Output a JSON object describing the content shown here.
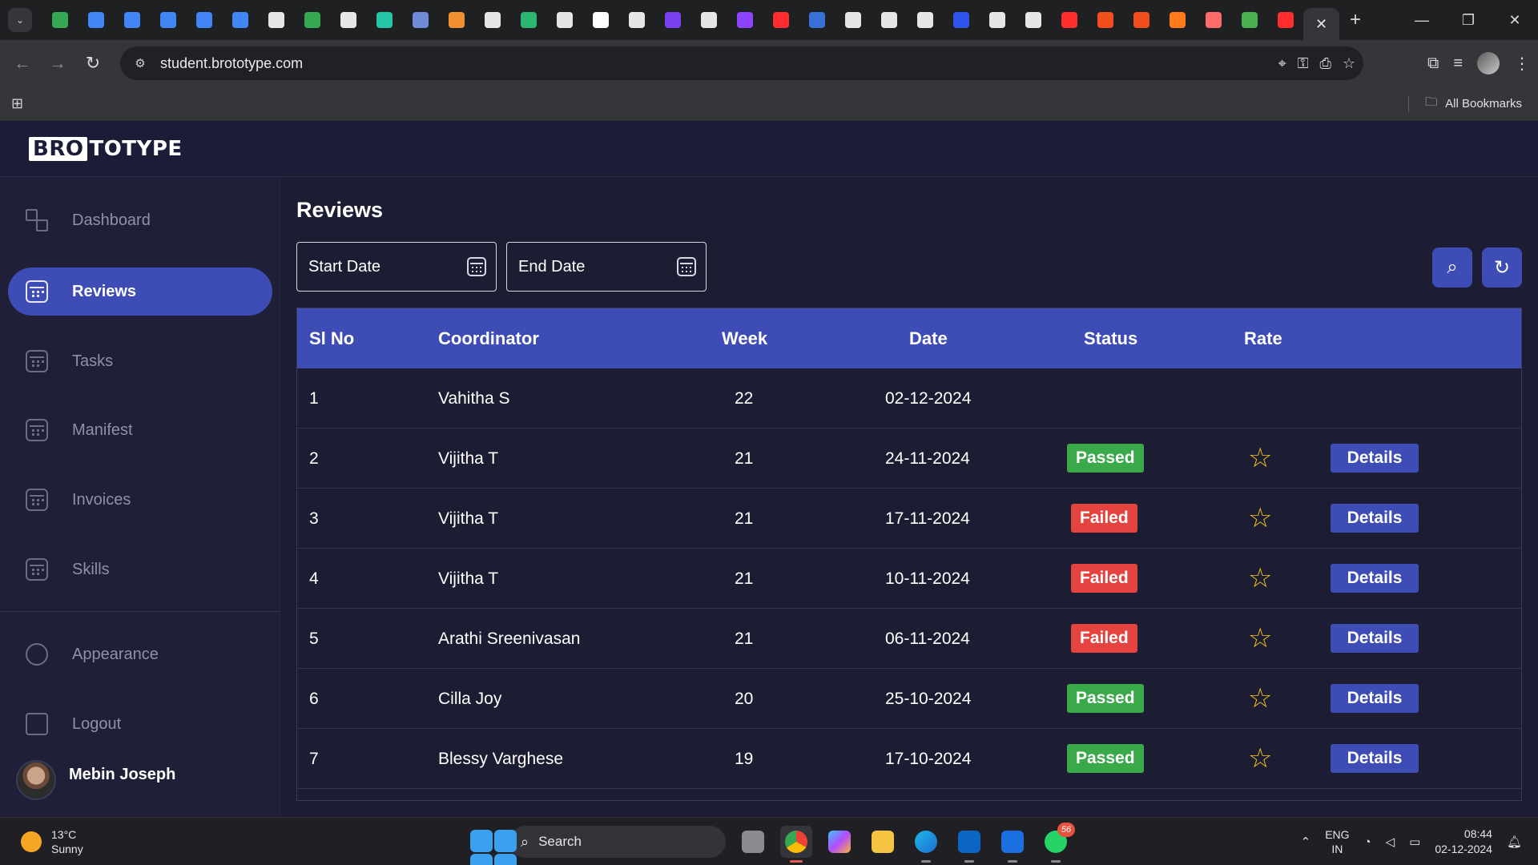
{
  "browser": {
    "url": "student.brototype.com",
    "bookmarks_label": "All Bookmarks",
    "favicon_colors": [
      "#34a853",
      "#4285f4",
      "#4285f4",
      "#4285f4",
      "#4285f4",
      "#4285f4",
      "#e6e6e6",
      "#34a853",
      "#e6e6e6",
      "#26c6a8",
      "#6f8bd8",
      "#f0902f",
      "#e6e6e6",
      "#2bb673",
      "#e6e6e6",
      "#ffffff",
      "#e6e6e6",
      "#7b3ff2",
      "#e6e6e6",
      "#8e44ff",
      "#ff2d2d",
      "#3b6fd8",
      "#e6e6e6",
      "#e6e6e6",
      "#e6e6e6",
      "#2f54eb",
      "#e6e6e6",
      "#e6e6e6",
      "#ff2d2d",
      "#f24e1e",
      "#f24e1e",
      "#ff7a1a",
      "#ff6b6b",
      "#4caf50",
      "#ff2d2d"
    ]
  },
  "app": {
    "logo_box": "BRO",
    "logo_rest": "TOTYPE"
  },
  "sidebar": {
    "items": [
      {
        "label": "Dashboard",
        "icon": "dashboard-icon"
      },
      {
        "label": "Reviews",
        "icon": "calendar-icon"
      },
      {
        "label": "Tasks",
        "icon": "calendar-icon"
      },
      {
        "label": "Manifest",
        "icon": "calendar-icon"
      },
      {
        "label": "Invoices",
        "icon": "calendar-icon"
      },
      {
        "label": "Skills",
        "icon": "calendar-icon"
      },
      {
        "label": "Appearance",
        "icon": "pen-icon"
      },
      {
        "label": "Logout",
        "icon": "logout-icon"
      }
    ],
    "active": "Reviews",
    "user_name": "Mebin Joseph"
  },
  "main": {
    "title": "Reviews",
    "start_date_label": "Start Date",
    "end_date_label": "End Date",
    "columns": [
      "Sl No",
      "Coordinator",
      "Week",
      "Date",
      "Status",
      "Rate"
    ],
    "details_label": "Details",
    "rows": [
      {
        "sl": "1",
        "coordinator": "Vahitha S",
        "week": "22",
        "date": "02-12-2024",
        "status": "",
        "rate": false,
        "details": false
      },
      {
        "sl": "2",
        "coordinator": "Vijitha T",
        "week": "21",
        "date": "24-11-2024",
        "status": "Passed",
        "rate": true,
        "details": true
      },
      {
        "sl": "3",
        "coordinator": "Vijitha T",
        "week": "21",
        "date": "17-11-2024",
        "status": "Failed",
        "rate": true,
        "details": true
      },
      {
        "sl": "4",
        "coordinator": "Vijitha T",
        "week": "21",
        "date": "10-11-2024",
        "status": "Failed",
        "rate": true,
        "details": true
      },
      {
        "sl": "5",
        "coordinator": "Arathi Sreenivasan",
        "week": "21",
        "date": "06-11-2024",
        "status": "Failed",
        "rate": true,
        "details": true
      },
      {
        "sl": "6",
        "coordinator": "Cilla Joy",
        "week": "20",
        "date": "25-10-2024",
        "status": "Passed",
        "rate": true,
        "details": true
      },
      {
        "sl": "7",
        "coordinator": "Blessy Varghese",
        "week": "19",
        "date": "17-10-2024",
        "status": "Passed",
        "rate": true,
        "details": true
      }
    ]
  },
  "taskbar": {
    "temperature": "13°C",
    "weather": "Sunny",
    "search_label": "Search",
    "lang_top": "ENG",
    "lang_bottom": "IN",
    "time": "08:44",
    "date": "02-12-2024",
    "whatsapp_badge": "56"
  }
}
